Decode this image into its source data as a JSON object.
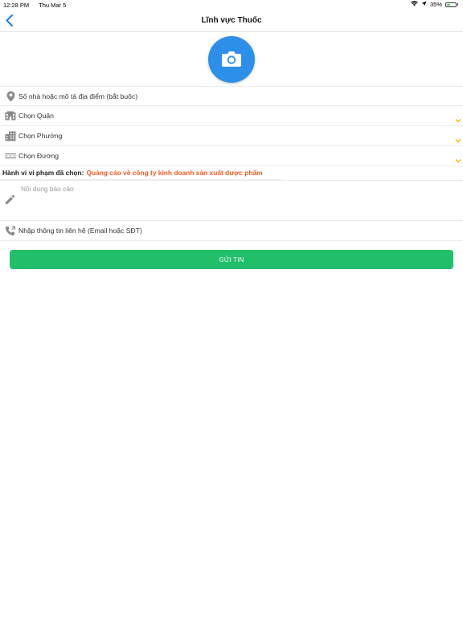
{
  "status_bar": {
    "time": "12:28 PM",
    "date": "Thu Mar 5",
    "battery": "35%",
    "battery_level": 0.35
  },
  "nav": {
    "title": "Lĩnh vực Thuốc"
  },
  "form": {
    "address_placeholder": "Số nhà hoặc mô tả địa điểm (bắt buộc)",
    "district_placeholder": "Chọn Quận",
    "ward_placeholder": "Chọn Phường",
    "street_placeholder": "Chọn Đường",
    "violation_label": "Hành vi vi phạm đã chọn:",
    "violation_value": "Quảng cáo về công ty kinh doanh sản xuất dược phẩm",
    "report_placeholder": "Nội dung báo cáo",
    "contact_placeholder": "Nhập thông tin liên hệ (Email hoặc SĐT)",
    "submit_label": "GỬI TIN"
  },
  "colors": {
    "accent_blue": "#2e8fe8",
    "submit_green": "#22bf6a",
    "violation_orange": "#f05a22",
    "chevron_yellow": "#f5b800"
  },
  "icons": [
    "back-chevron-icon",
    "camera-icon",
    "location-pin-icon",
    "district-building-icon",
    "ward-building-icon",
    "road-icon",
    "chevron-down-icon",
    "pencil-icon",
    "contact-phone-icon"
  ]
}
